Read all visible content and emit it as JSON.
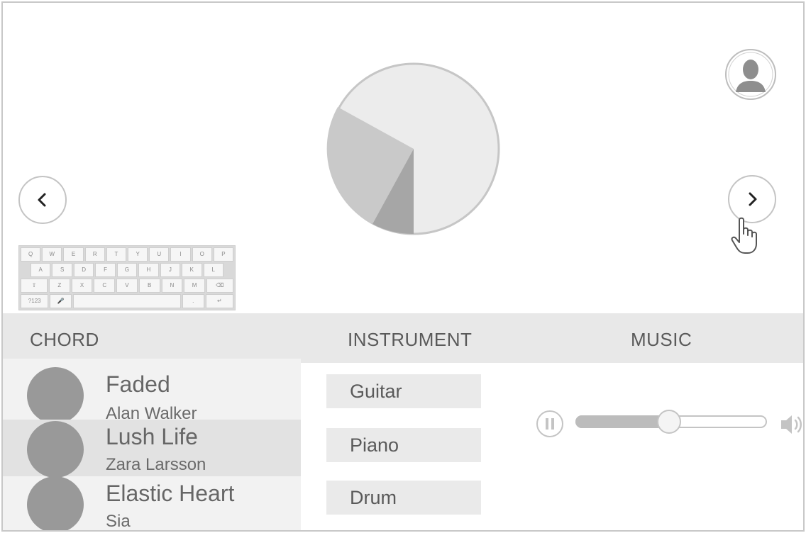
{
  "tabs": {
    "chord": "CHORD",
    "instrument": "INSTRUMENT",
    "music": "MUSIC"
  },
  "chords": [
    {
      "title": "Faded",
      "artist": "Alan Walker",
      "selected": false
    },
    {
      "title": "Lush Life",
      "artist": "Zara Larsson",
      "selected": true
    },
    {
      "title": "Elastic Heart",
      "artist": "Sia",
      "selected": false
    }
  ],
  "instruments": [
    "Guitar",
    "Piano",
    "Drum"
  ],
  "player": {
    "progress": 0.49
  },
  "keyboard": {
    "row1": [
      "Q",
      "W",
      "E",
      "R",
      "T",
      "Y",
      "U",
      "I",
      "O",
      "P"
    ],
    "row2": [
      "A",
      "S",
      "D",
      "F",
      "G",
      "H",
      "J",
      "K",
      "L"
    ],
    "row3": [
      "⇧",
      "Z",
      "X",
      "C",
      "V",
      "B",
      "N",
      "M",
      "⌫"
    ],
    "row4": [
      "?123",
      "🎤",
      "",
      ".",
      "↵"
    ]
  },
  "colors": {
    "wheel_base": "#ececec",
    "wheel_dark": "#a6a6a6",
    "wheel_mid": "#c9c9c9",
    "accent_gray": "#999999"
  }
}
